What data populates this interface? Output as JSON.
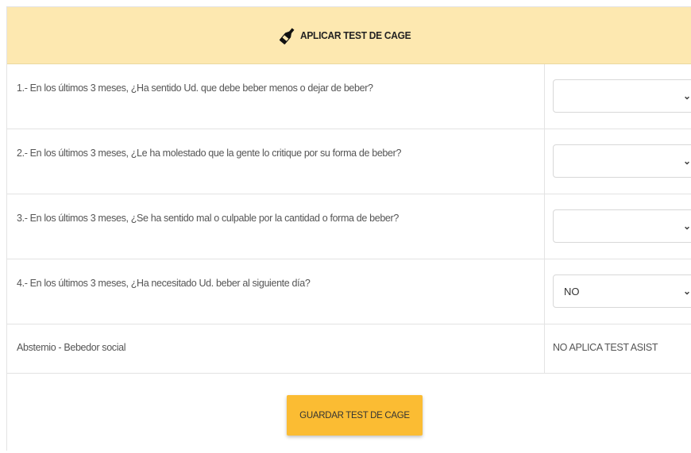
{
  "header": {
    "title": "APLICAR TEST DE CAGE",
    "icon": "bottle-icon"
  },
  "questions": [
    {
      "text": "1.- En los últimos 3 meses, ¿Ha sentido Ud. que debe beber menos o dejar de beber?",
      "selected": ""
    },
    {
      "text": "2.- En los últimos 3 meses, ¿Le ha molestado que la gente lo critique por su forma de beber?",
      "selected": ""
    },
    {
      "text": "3.- En los últimos 3 meses, ¿Se ha sentido mal o culpable por la cantidad o forma de beber?",
      "selected": ""
    },
    {
      "text": "4.- En los últimos 3 meses, ¿Ha necesitado Ud. beber al siguiente día?",
      "selected": "NO"
    }
  ],
  "result": {
    "label": "Abstemio - Bebedor social",
    "value": "NO APLICA TEST ASIST"
  },
  "footer": {
    "save_label": "GUARDAR TEST DE CAGE"
  },
  "colors": {
    "header_bg": "#fde8b0",
    "button_bg": "#fbbc33"
  }
}
